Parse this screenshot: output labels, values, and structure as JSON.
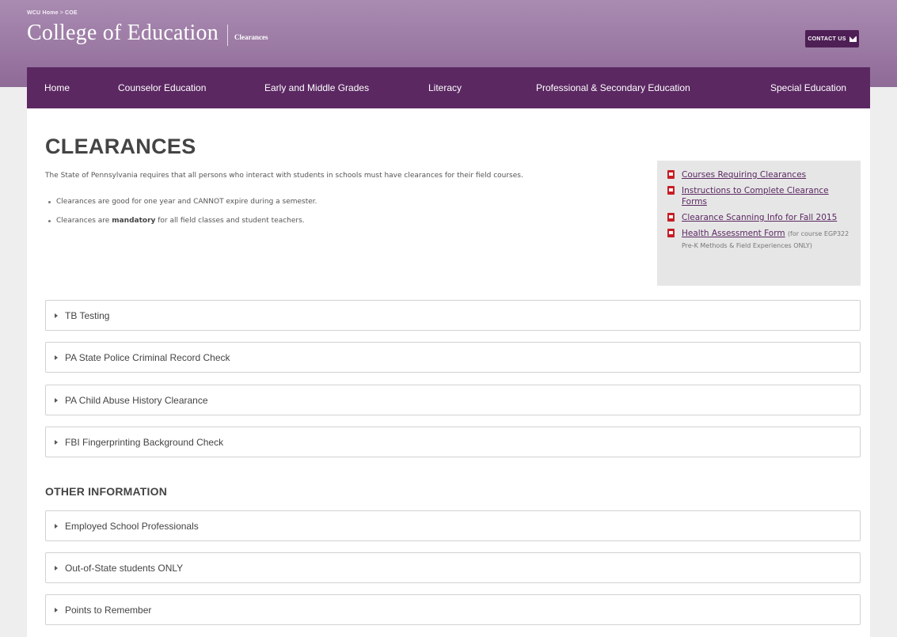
{
  "header": {
    "breadcrumb": [
      "WCU Home",
      "COE"
    ],
    "breadcrumb_sep": ">",
    "site_title": "College of Education",
    "section_name": "Clearances",
    "contact_label": "CONTACT US"
  },
  "nav": {
    "items": [
      {
        "label": "Home"
      },
      {
        "label": "Counselor Education"
      },
      {
        "label": "Early and Middle Grades"
      },
      {
        "label": "Literacy"
      },
      {
        "label": "Professional & Secondary Education"
      },
      {
        "label": "Special Education"
      }
    ]
  },
  "main": {
    "title": "CLEARANCES",
    "intro": "The State of Pennsylvania requires that all persons who interact with students in schools must have clearances for their field courses.",
    "bullets": [
      {
        "text": "Clearances are good for one year and CANNOT expire during a semester."
      },
      {
        "before": "Clearances are ",
        "strong": "mandatory",
        "after": " for all field classes and student teachers."
      }
    ],
    "sidebar": [
      {
        "link": "Courses Requiring Clearances",
        "note": ""
      },
      {
        "link": "Instructions to Complete Clearance Forms",
        "note": ""
      },
      {
        "link": "Clearance Scanning Info for Fall 2015",
        "note": ""
      },
      {
        "link": "Health Assessment Form",
        "note": "(for course EGP322 Pre-K Methods & Field Experiences ONLY)"
      }
    ],
    "accordions": [
      {
        "label": "TB Testing"
      },
      {
        "label": "PA State Police Criminal Record Check"
      },
      {
        "label": "PA Child Abuse History Clearance"
      },
      {
        "label": "FBI Fingerprinting Background Check"
      }
    ],
    "other_heading": "OTHER INFORMATION",
    "other_accordions": [
      {
        "label": "Employed School Professionals"
      },
      {
        "label": "Out-of-State students ONLY"
      },
      {
        "label": "Points to Remember"
      }
    ]
  },
  "colors": {
    "brand_purple": "#5b2862",
    "header_purple": "#9d7aa6",
    "contact_button": "#4e1f55",
    "pdf_icon": "#c81d25"
  }
}
